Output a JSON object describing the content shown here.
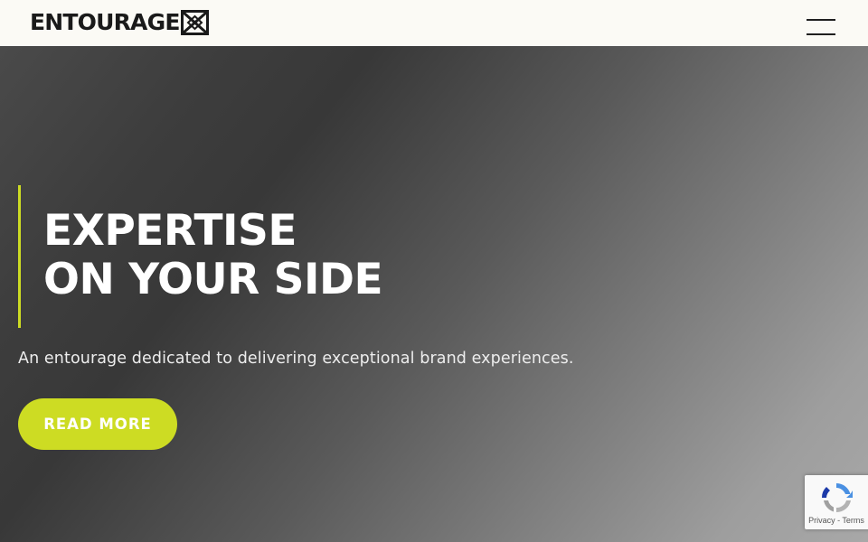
{
  "header": {
    "logo_text": "ENTOURAGE",
    "logo_mark_icon": "entourage-x-mark-icon",
    "menu_icon": "hamburger-menu-icon",
    "background": "#fbfaf5"
  },
  "hero": {
    "title_line1": "EXPERTISE",
    "title_line2": "ON YOUR SIDE",
    "subtitle": "An entourage dedicated to delivering exceptional brand experiences.",
    "cta_label": "READ MORE",
    "accent_color": "#cddc23"
  },
  "recaptcha": {
    "icon": "recaptcha-icon",
    "links_text": "Privacy - Terms"
  }
}
